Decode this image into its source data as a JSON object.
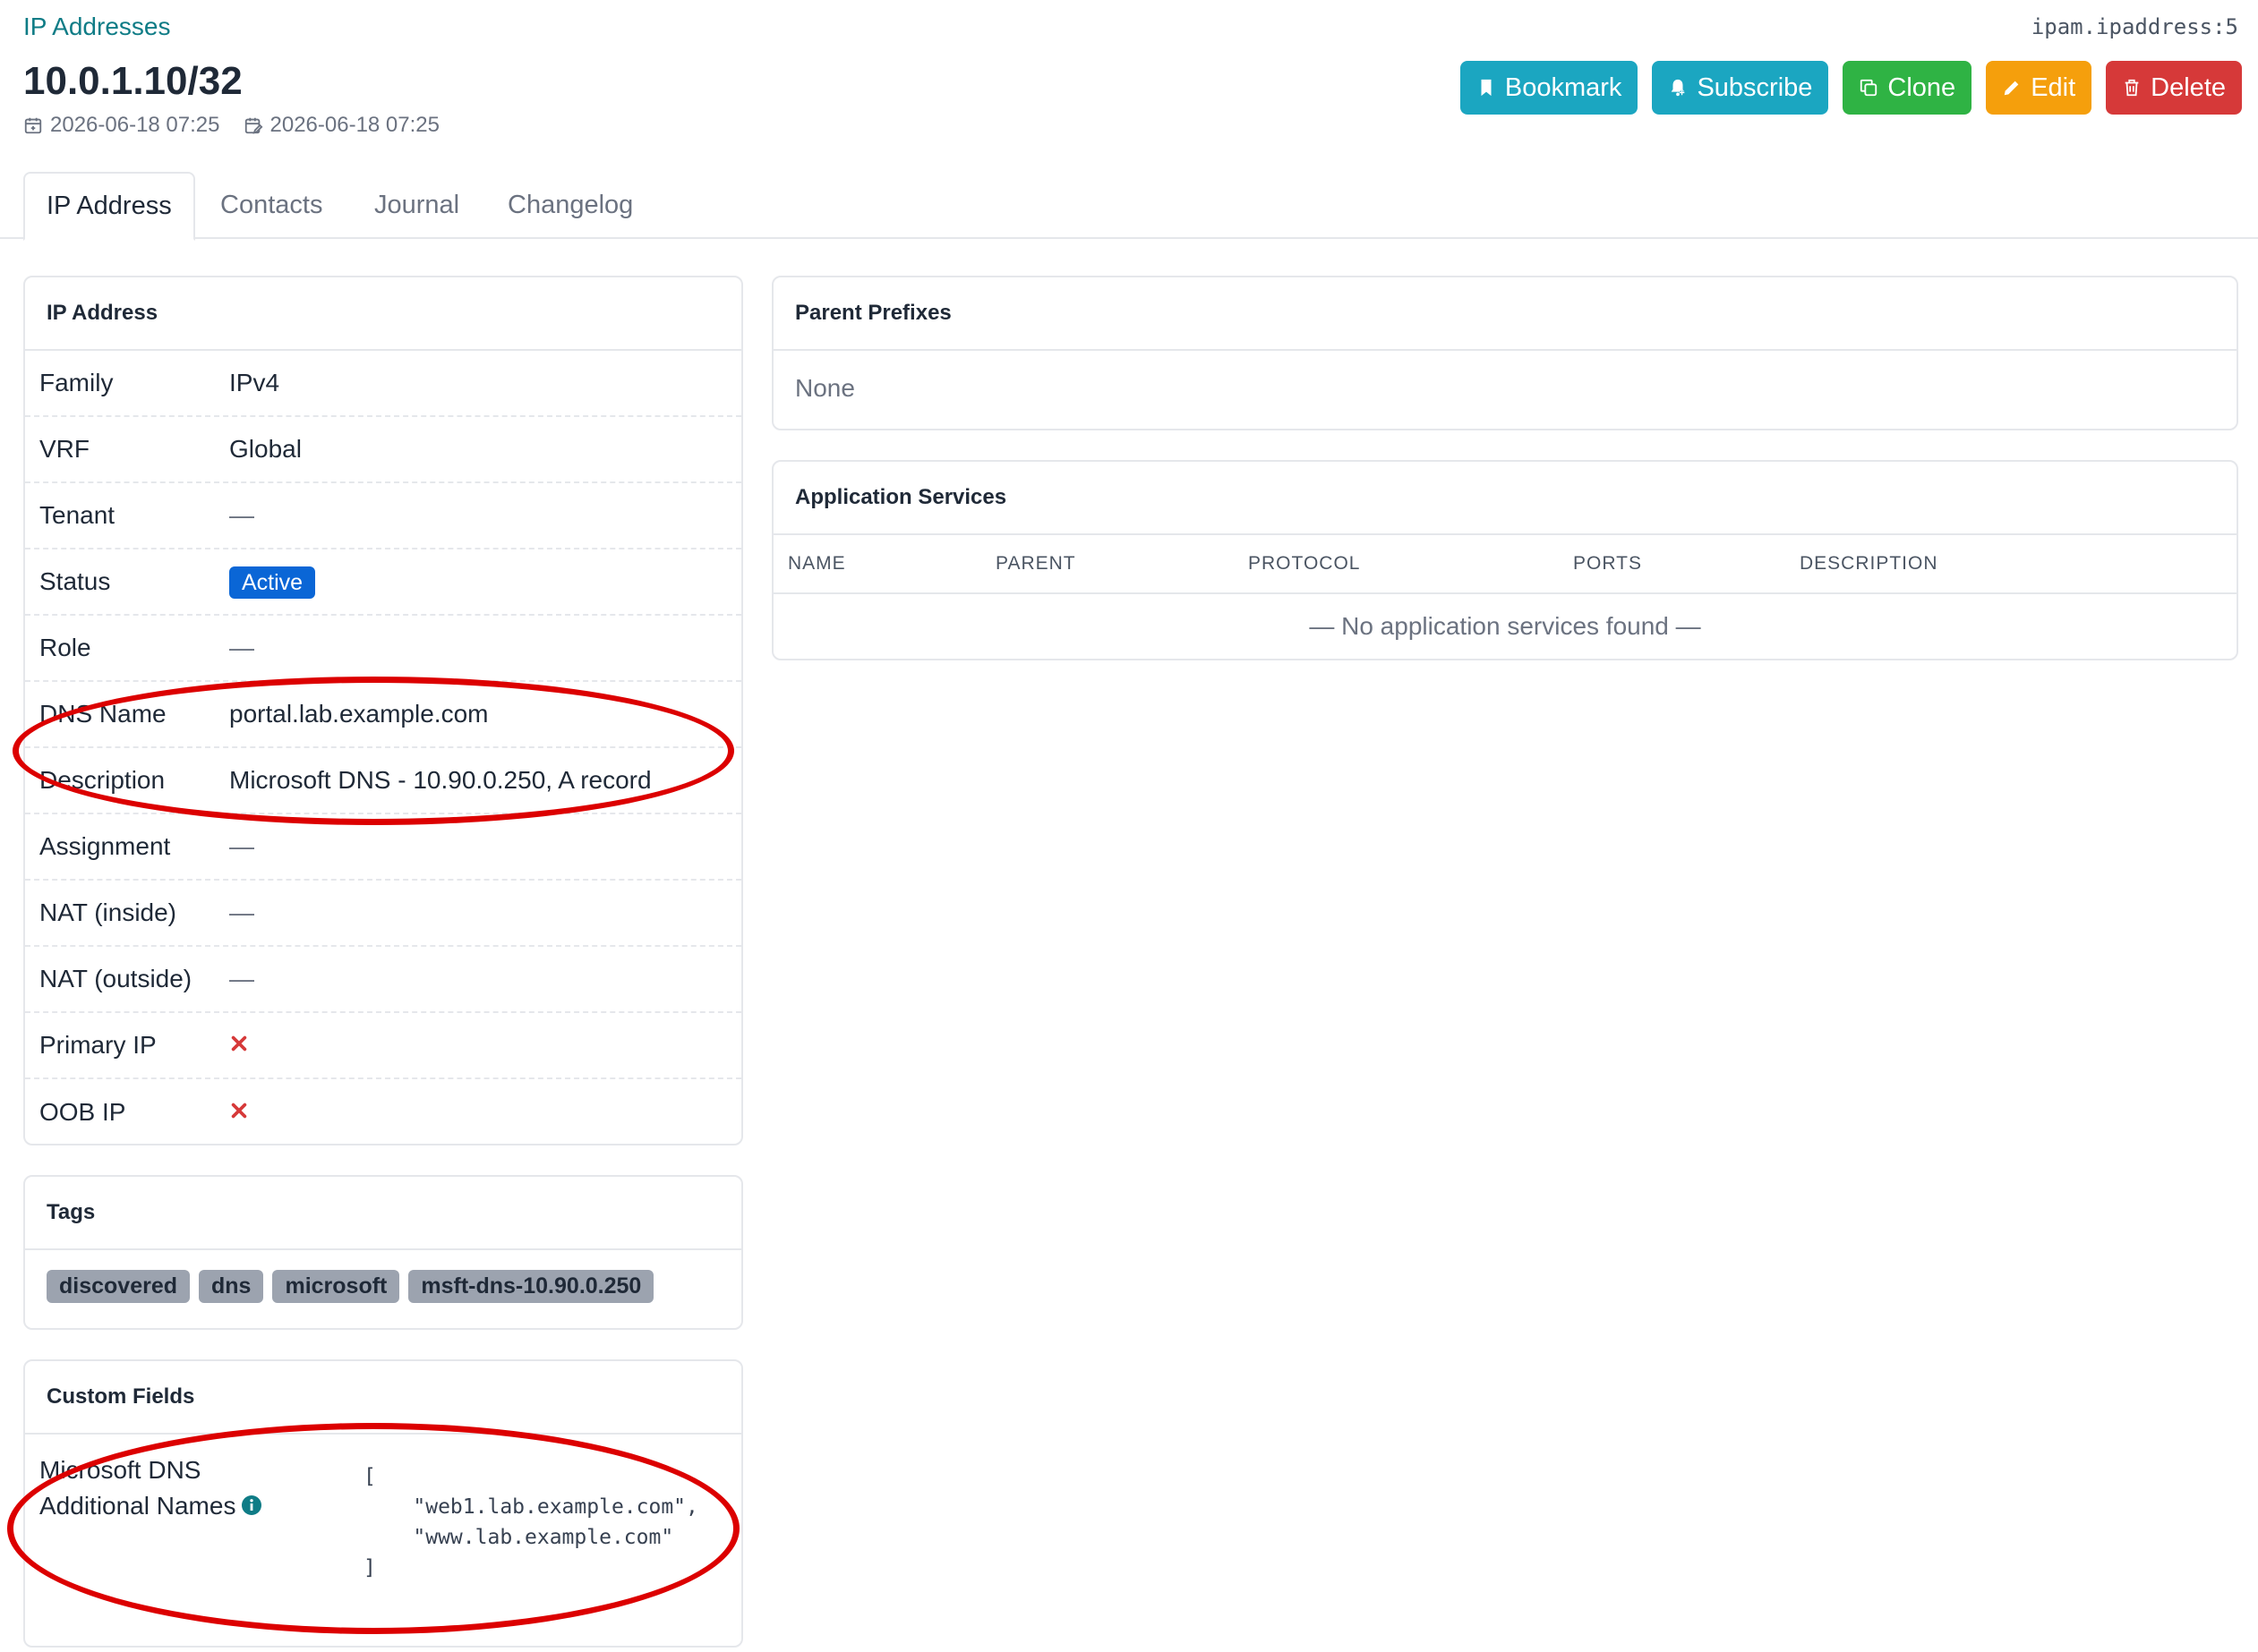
{
  "breadcrumb": "IP Addresses",
  "object_id": "ipam.ipaddress:5",
  "title": "10.0.1.10/32",
  "created": "2026-06-18 07:25",
  "updated": "2026-06-18 07:25",
  "actions": {
    "bookmark": "Bookmark",
    "subscribe": "Subscribe",
    "clone": "Clone",
    "edit": "Edit",
    "delete": "Delete"
  },
  "tabs": [
    "IP Address",
    "Contacts",
    "Journal",
    "Changelog"
  ],
  "ip_card": {
    "header": "IP Address",
    "rows": [
      {
        "label": "Family",
        "value": "IPv4"
      },
      {
        "label": "VRF",
        "value": "Global"
      },
      {
        "label": "Tenant",
        "value": "—"
      },
      {
        "label": "Status",
        "value": "Active"
      },
      {
        "label": "Role",
        "value": "—"
      },
      {
        "label": "DNS Name",
        "value": "portal.lab.example.com"
      },
      {
        "label": "Description",
        "value": "Microsoft DNS - 10.90.0.250, A record"
      },
      {
        "label": "Assignment",
        "value": "—"
      },
      {
        "label": "NAT (inside)",
        "value": "—"
      },
      {
        "label": "NAT (outside)",
        "value": "—"
      },
      {
        "label": "Primary IP",
        "value": "false"
      },
      {
        "label": "OOB IP",
        "value": "false"
      }
    ]
  },
  "tags_card": {
    "header": "Tags",
    "tags": [
      "discovered",
      "dns",
      "microsoft",
      "msft-dns-10.90.0.250"
    ]
  },
  "custom_fields": {
    "header": "Custom Fields",
    "label_line1": "Microsoft DNS",
    "label_line2": "Additional Names",
    "value": "[\n    \"web1.lab.example.com\",\n    \"www.lab.example.com\"\n]"
  },
  "parent_prefixes": {
    "header": "Parent Prefixes",
    "empty": "None"
  },
  "app_services": {
    "header": "Application Services",
    "columns": [
      "NAME",
      "PARENT",
      "PROTOCOL",
      "PORTS",
      "DESCRIPTION"
    ],
    "empty": "— No application services found —"
  },
  "colors": {
    "accent": "#0f7c86",
    "status_active": "#0a66d6",
    "annotation": "#dc0000",
    "false_icon": "#d63939"
  }
}
